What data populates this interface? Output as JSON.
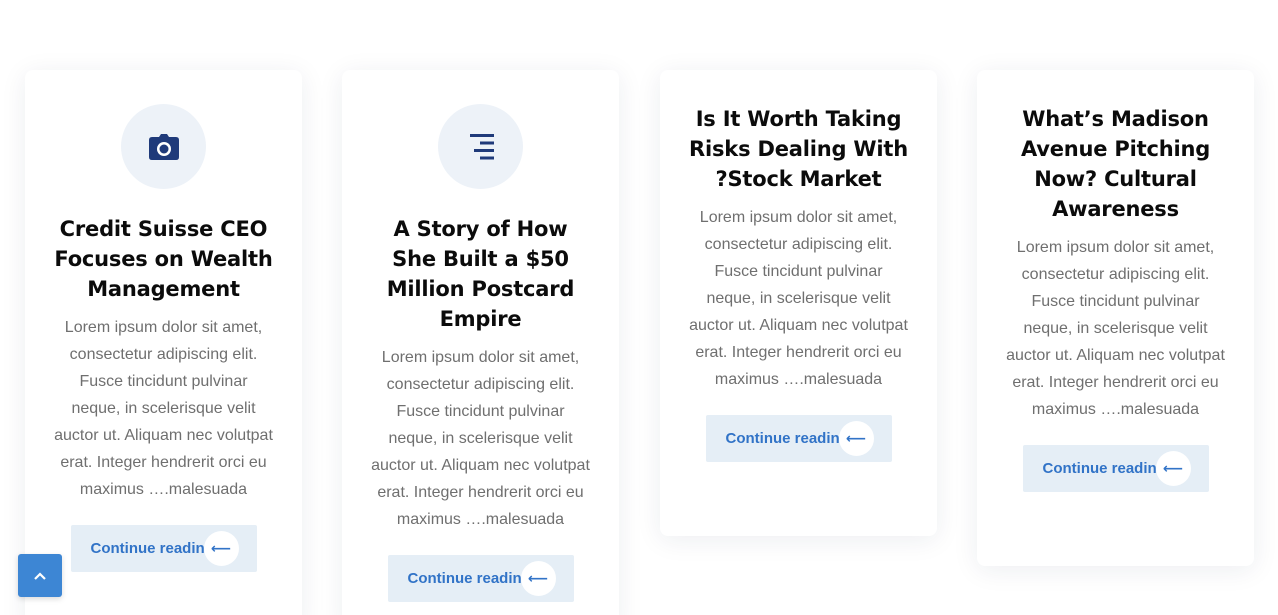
{
  "cards": [
    {
      "icon": "camera-icon",
      "title": "Credit Suisse CEO Focuses on Wealth Management",
      "excerpt": "Lorem ipsum dolor sit amet, consectetur adipiscing elit. Fusce tincidunt pulvinar neque, in scelerisque velit auctor ut. Aliquam nec volutpat erat. Integer hendrerit orci eu maximus ….malesuada",
      "button": "Continue reading",
      "arrow": "⟵"
    },
    {
      "icon": "align-right-icon",
      "title": "A Story of How She Built a $50 Million Postcard Empire",
      "excerpt": "Lorem ipsum dolor sit amet, consectetur adipiscing elit. Fusce tincidunt pulvinar neque, in scelerisque velit auctor ut. Aliquam nec volutpat erat. Integer hendrerit orci eu maximus ….malesuada",
      "button": "Continue reading",
      "arrow": "⟵"
    },
    {
      "title": "Is It Worth Taking Risks Dealing With ?Stock Market",
      "excerpt": "Lorem ipsum dolor sit amet, consectetur adipiscing elit. Fusce tincidunt pulvinar neque, in scelerisque velit auctor ut. Aliquam nec volutpat erat. Integer hendrerit orci eu maximus ….malesuada",
      "button": "Continue reading",
      "arrow": "⟵"
    },
    {
      "title": "What’s Madison Avenue Pitching Now? Cultural Awareness",
      "excerpt": "Lorem ipsum dolor sit amet, consectetur adipiscing elit. Fusce tincidunt pulvinar neque, in scelerisque velit auctor ut. Aliquam nec volutpat erat. Integer hendrerit orci eu maximus ….malesuada",
      "button": "Continue reading",
      "arrow": "⟵"
    }
  ],
  "scroll_top": {
    "icon": "chevron-up-icon"
  },
  "colors": {
    "accent": "#3173c7",
    "icon_navy": "#1f3a7a",
    "button_bg": "#e5eef6",
    "scroll_top_bg": "#3d86d4"
  }
}
